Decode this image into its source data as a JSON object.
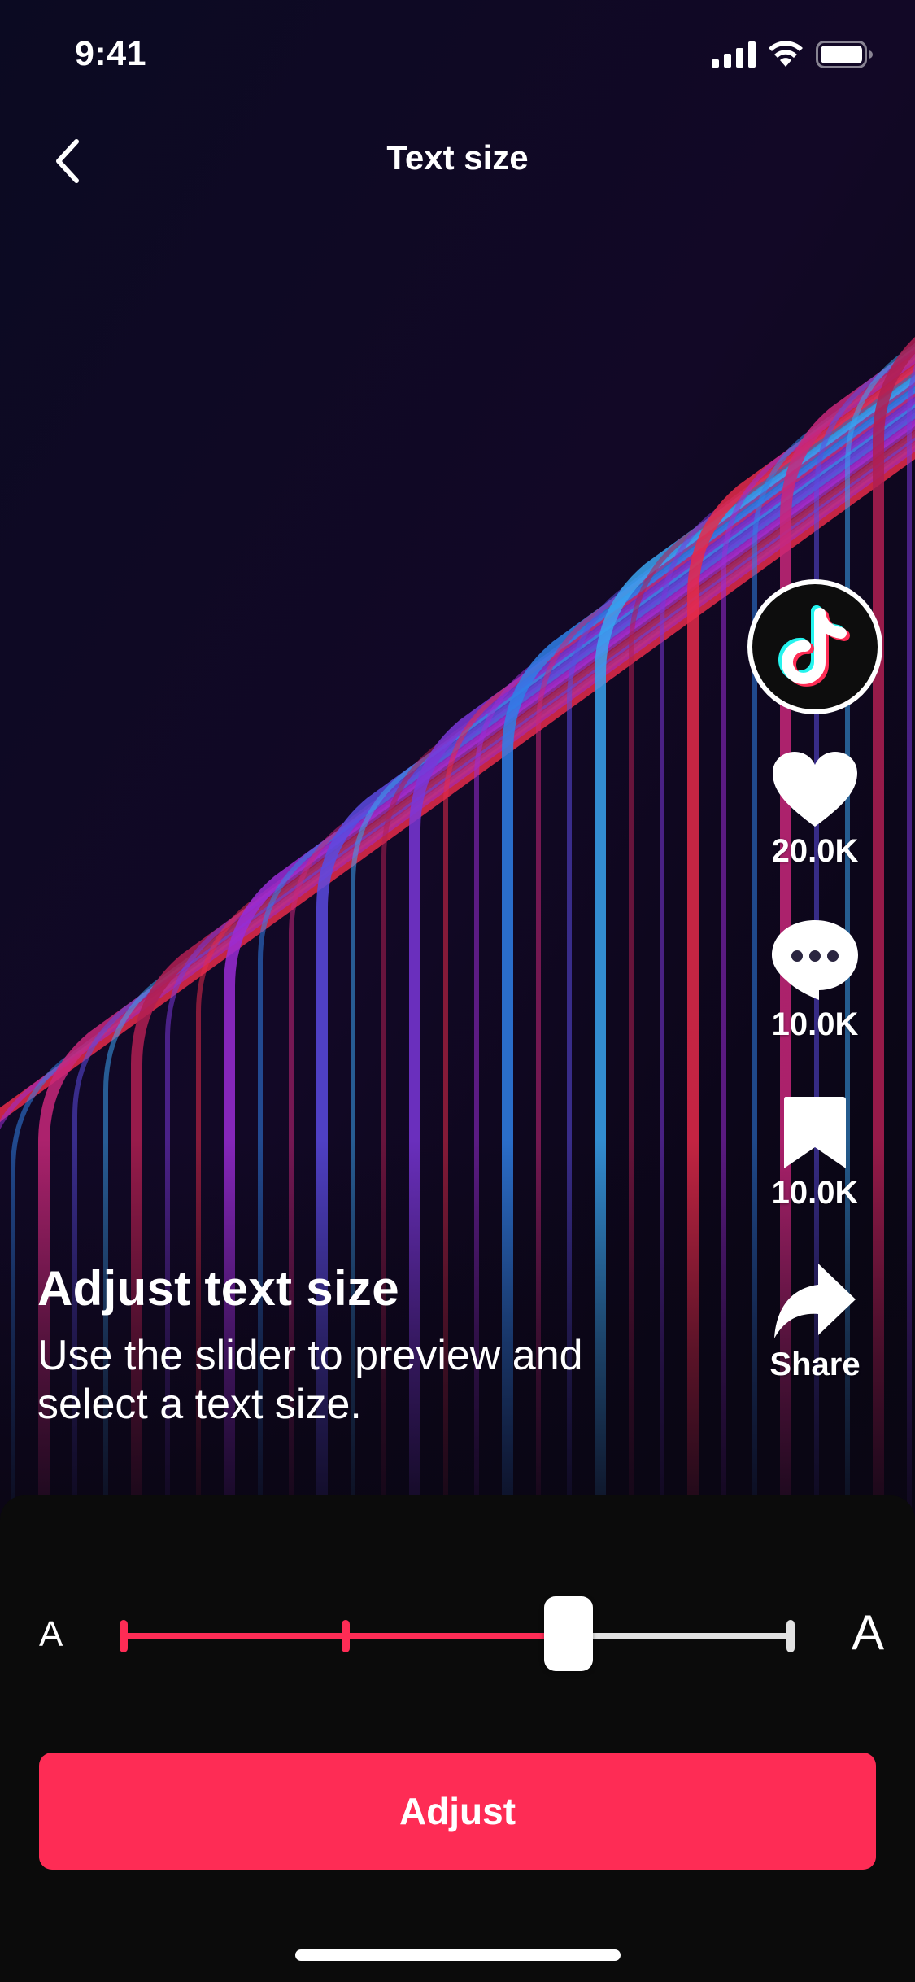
{
  "status_bar": {
    "time": "9:41",
    "icons": [
      "cellular-signal-icon",
      "wifi-icon",
      "battery-icon"
    ]
  },
  "nav": {
    "back_icon": "chevron-left-icon",
    "title": "Text size"
  },
  "actions": {
    "profile_icon": "tiktok-logo-icon",
    "like": {
      "icon": "heart-icon",
      "count": "20.0K"
    },
    "comment": {
      "icon": "comment-bubble-icon",
      "count": "10.0K"
    },
    "save": {
      "icon": "bookmark-icon",
      "count": "10.0K"
    },
    "share": {
      "icon": "share-arrow-icon",
      "label": "Share"
    }
  },
  "caption": {
    "title": "Adjust text size",
    "description": "Use the slider to preview and select a text size."
  },
  "slider": {
    "min_label": "A",
    "max_label": "A",
    "steps": 4,
    "selected_step": 2,
    "value_fraction": 0.667
  },
  "primary_button": {
    "label": "Adjust"
  },
  "colors": {
    "accent": "#fe2c55",
    "sheet_background": "#0b0b0b",
    "track_inactive": "#e2e2e2",
    "text": "#ffffff"
  }
}
